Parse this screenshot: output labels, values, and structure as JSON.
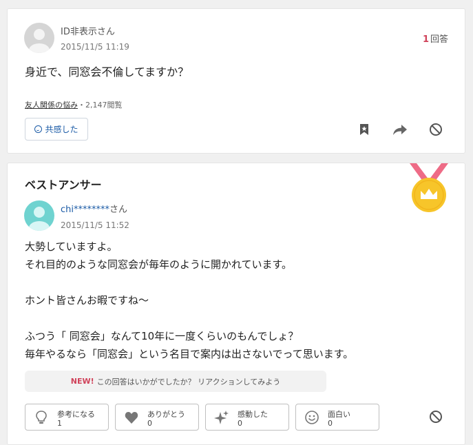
{
  "question": {
    "user": {
      "name": "ID非表示さん"
    },
    "date": "2015/11/5 11:19",
    "answer_count": {
      "num": "1",
      "label": "回答"
    },
    "title": "身近で、同窓会不倫してますか？",
    "category": "友人関係の悩み",
    "separator": "・",
    "views": "2,147閲覧",
    "empathy_label": "共感した"
  },
  "answer": {
    "heading": "ベストアンサー",
    "user": {
      "handle": "chi********",
      "suffix": "さん"
    },
    "date": "2015/11/5 11:52",
    "body": [
      "大勢していますよ。",
      "それ目的のような同窓会が毎年のように開かれています。",
      "",
      "ホント皆さんお暇ですね～",
      "",
      "ふつう「 同窓会」なんて10年に一度くらいのもんでしょ？",
      "毎年やるなら「同窓会」という名目で案内は出さないでって思います。"
    ],
    "prompt": {
      "new": "NEW!",
      "text": "この回答はいかがでしたか？ リアクションしてみよう"
    },
    "reactions": [
      {
        "label": "参考になる",
        "count": "1",
        "icon": "lightbulb-icon"
      },
      {
        "label": "ありがとう",
        "count": "0",
        "icon": "heart-icon"
      },
      {
        "label": "感動した",
        "count": "0",
        "icon": "sparkle-icon"
      },
      {
        "label": "面白い",
        "count": "0",
        "icon": "smile-icon"
      }
    ]
  },
  "colors": {
    "accent_pink": "#d0425a",
    "link_blue": "#1a5aa6",
    "medal_gold": "#f7c52a",
    "ribbon_pink": "#ee6b86",
    "avatar_teal": "#6fd3d0"
  }
}
